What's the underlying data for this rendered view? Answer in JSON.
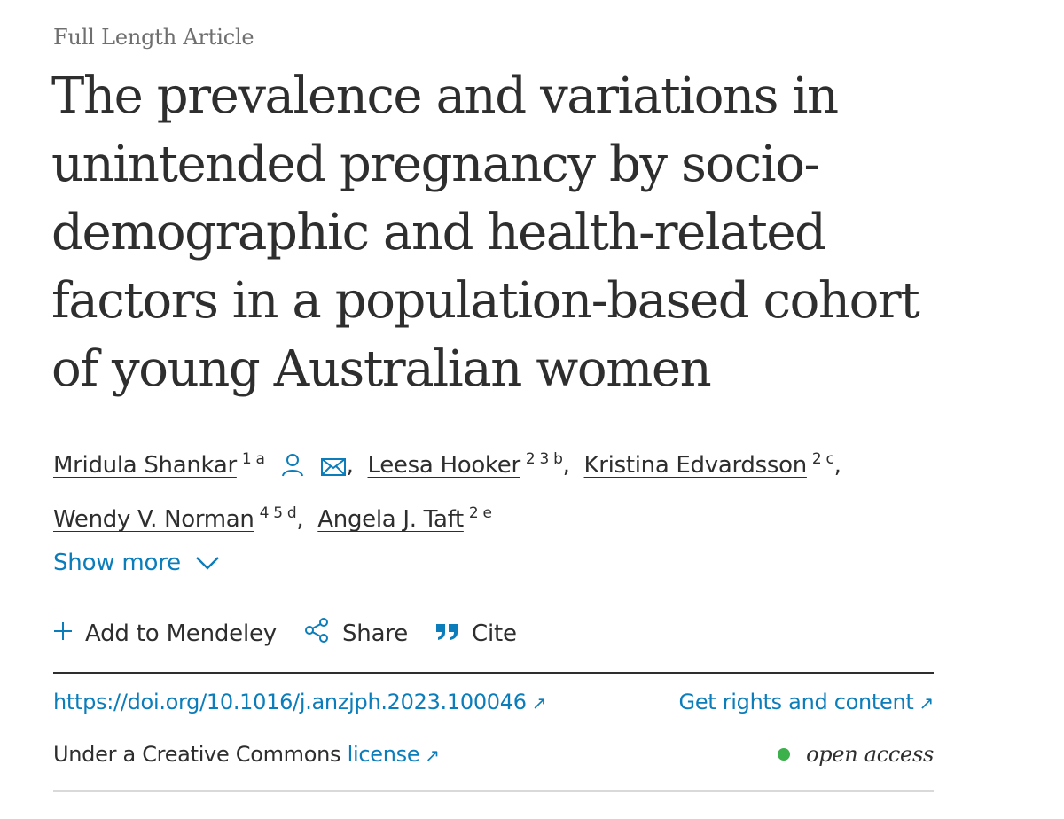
{
  "article": {
    "type": "Full Length Article",
    "title_lines": [
      "The prevalence and variations in",
      "unintended pregnancy by socio-",
      "demographic and health-related",
      "factors in a population-based cohort",
      "of young Australian women"
    ]
  },
  "authors": [
    {
      "name": "Mridula Shankar",
      "sup": "1 a"
    },
    {
      "name": "Leesa Hooker",
      "sup": "2 3 b"
    },
    {
      "name": "Kristina Edvardsson",
      "sup": "2 c"
    },
    {
      "name": "Wendy V. Norman",
      "sup": "4 5 d"
    },
    {
      "name": "Angela J. Taft",
      "sup": "2 e"
    }
  ],
  "show_more": {
    "label": "Show more",
    "icon": "chevron-down-icon"
  },
  "toolbar": {
    "mendeley_label": "Add to Mendeley",
    "share_label": "Share",
    "cite_label": "Cite"
  },
  "doi": {
    "text": "https://doi.org/10.1016/j.anzjph.2023.100046"
  },
  "rights": {
    "text": "Get rights and content"
  },
  "license": {
    "prefix": "Under a Creative Commons",
    "link": "license"
  },
  "access": {
    "label": "open access",
    "dot_color": "#3cb04a"
  },
  "colors": {
    "link": "#0c7dbb",
    "text": "#2e2e2e"
  }
}
